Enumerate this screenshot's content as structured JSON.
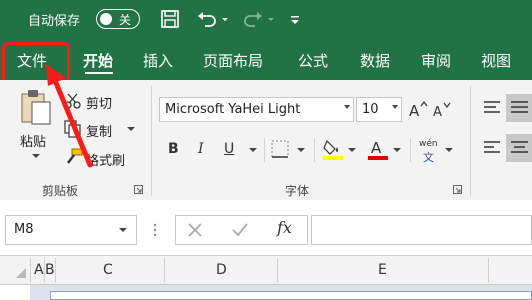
{
  "quick_access": {
    "autosave_label": "自动保存",
    "autosave_state": "关"
  },
  "tabs": [
    {
      "label": "文件"
    },
    {
      "label": "开始"
    },
    {
      "label": "插入"
    },
    {
      "label": "页面布局"
    },
    {
      "label": "公式"
    },
    {
      "label": "数据"
    },
    {
      "label": "审阅"
    },
    {
      "label": "视图"
    }
  ],
  "clipboard": {
    "paste": "粘贴",
    "cut": "剪切",
    "copy": "复制",
    "format_painter": "格式刷",
    "group": "剪贴板"
  },
  "font": {
    "name": "Microsoft YaHei Light",
    "size": "10",
    "group": "字体",
    "bold": "B",
    "italic": "I",
    "underline": "U",
    "phonetic": "wén",
    "phonetic_char": "文",
    "highlight_color": "#ffff00",
    "font_color": "#e00000"
  },
  "formula_bar": {
    "name_box": "M8",
    "fx": "fx"
  },
  "columns": [
    "A",
    "B",
    "C",
    "D",
    "E"
  ],
  "colors": {
    "brand": "#217346",
    "annotation": "#ff1a1a"
  }
}
